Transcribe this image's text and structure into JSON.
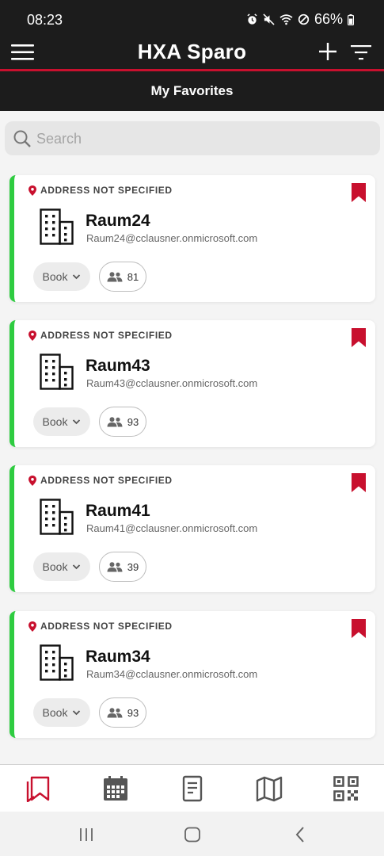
{
  "status_bar": {
    "time": "08:23",
    "battery_percent": "66%",
    "icons": [
      "alarm-icon",
      "mute-icon",
      "wifi-icon",
      "dnd-icon",
      "battery-icon"
    ]
  },
  "app_bar": {
    "title": "HXA Sparo",
    "icons": [
      "menu-icon",
      "plus-icon",
      "filter-icon"
    ]
  },
  "subheader": {
    "title": "My Favorites"
  },
  "search": {
    "placeholder": "Search",
    "value": ""
  },
  "rooms": [
    {
      "address": "ADDRESS NOT SPECIFIED",
      "name": "Raum24",
      "email": "Raum24@cclausner.onmicrosoft.com",
      "book_label": "Book",
      "capacity": "81"
    },
    {
      "address": "ADDRESS NOT SPECIFIED",
      "name": "Raum43",
      "email": "Raum43@cclausner.onmicrosoft.com",
      "book_label": "Book",
      "capacity": "93"
    },
    {
      "address": "ADDRESS NOT SPECIFIED",
      "name": "Raum41",
      "email": "Raum41@cclausner.onmicrosoft.com",
      "book_label": "Book",
      "capacity": "39"
    },
    {
      "address": "ADDRESS NOT SPECIFIED",
      "name": "Raum34",
      "email": "Raum34@cclausner.onmicrosoft.com",
      "book_label": "Book",
      "capacity": "93"
    }
  ],
  "bottom_nav": {
    "items": [
      "bookmarks-icon",
      "calendar-icon",
      "document-icon",
      "map-icon",
      "qr-code-icon"
    ],
    "active": "bookmarks-icon"
  },
  "colors": {
    "accent": "#c8102e",
    "card_stripe": "#2ecc40",
    "header_bg": "#1c1c1c"
  }
}
